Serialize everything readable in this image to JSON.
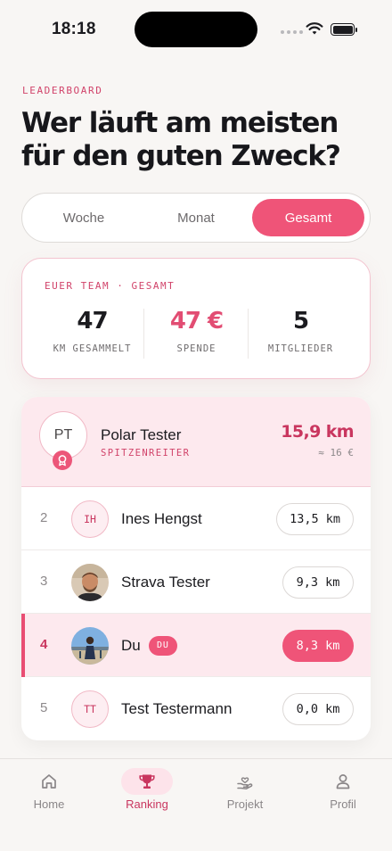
{
  "status_bar": {
    "time": "18:18"
  },
  "eyebrow": "LEADERBOARD",
  "title": "Wer läuft am meisten für den guten Zweck?",
  "period_tabs": [
    {
      "label": "Woche",
      "selected": false
    },
    {
      "label": "Monat",
      "selected": false
    },
    {
      "label": "Gesamt",
      "selected": true
    }
  ],
  "team": {
    "label": "EUER TEAM · GESAMT",
    "stats": [
      {
        "value": "47",
        "label": "KM GESAMMELT"
      },
      {
        "value": "47 €",
        "label": "SPENDE"
      },
      {
        "value": "5",
        "label": "MITGLIEDER"
      }
    ]
  },
  "leader": {
    "initials": "PT",
    "name": "Polar Tester",
    "tag": "SPITZENREITER",
    "km": "15,9 km",
    "euro": "≈ 16 €"
  },
  "rows": [
    {
      "rank": "2",
      "initials": "IH",
      "name": "Ines Hengst",
      "km": "13,5 km",
      "avatar": "initials"
    },
    {
      "rank": "3",
      "initials": "",
      "name": "Strava Tester",
      "km": "9,3 km",
      "avatar": "photo"
    },
    {
      "rank": "4",
      "initials": "",
      "name": "Du",
      "badge": "DU",
      "km": "8,3 km",
      "avatar": "photo",
      "is_self": true
    },
    {
      "rank": "5",
      "initials": "TT",
      "name": "Test Testermann",
      "km": "0,0 km",
      "avatar": "initials"
    }
  ],
  "tabbar": [
    {
      "label": "Home",
      "icon": "home-icon",
      "active": false
    },
    {
      "label": "Ranking",
      "icon": "trophy-icon",
      "active": true
    },
    {
      "label": "Projekt",
      "icon": "hand-heart-icon",
      "active": false
    },
    {
      "label": "Profil",
      "icon": "user-icon",
      "active": false
    }
  ],
  "colors": {
    "accent": "#ef5478",
    "accent_dark": "#c9365f",
    "background": "#f8f6f4",
    "highlight_row": "#fde9ee"
  }
}
